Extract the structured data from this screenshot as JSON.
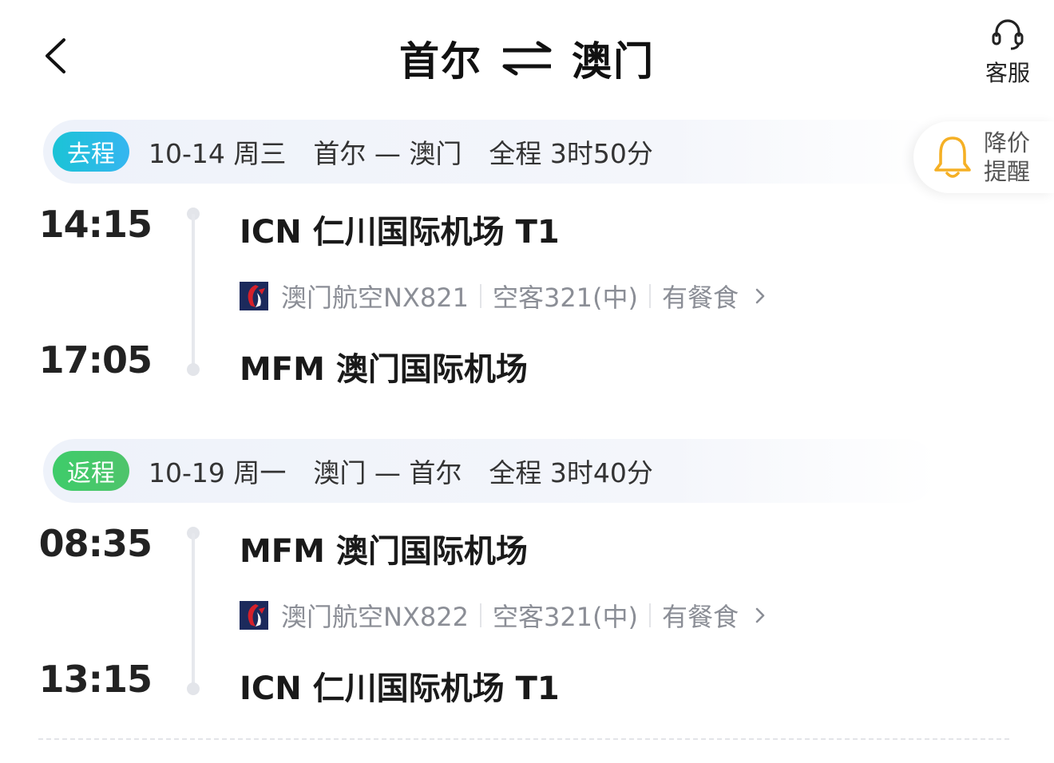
{
  "header": {
    "from": "首尔",
    "to": "澳门",
    "customer_service": "客服"
  },
  "price_alert": {
    "line1": "降价",
    "line2": "提醒"
  },
  "outbound": {
    "tag": "去程",
    "date": "10-14 周三",
    "route": "首尔 — 澳门",
    "duration": "全程 3时50分",
    "depart_time": "14:15",
    "depart_airport": "ICN 仁川国际机场 T1",
    "flight": "澳门航空NX821",
    "aircraft": "空客321(中)",
    "meal": "有餐食",
    "arrive_time": "17:05",
    "arrive_airport": "MFM 澳门国际机场"
  },
  "return": {
    "tag": "返程",
    "date": "10-19 周一",
    "route": "澳门 — 首尔",
    "duration": "全程 3时40分",
    "depart_time": "08:35",
    "depart_airport": "MFM 澳门国际机场",
    "flight": "澳门航空NX822",
    "aircraft": "空客321(中)",
    "meal": "有餐食",
    "arrive_time": "13:15",
    "arrive_airport": "ICN 仁川国际机场 T1"
  },
  "colors": {
    "outbound_tag": "#1bc3d6",
    "return_tag": "#3ecc6a",
    "alert_bell": "#f5b025",
    "airline_red": "#d6202a",
    "airline_navy": "#1c2a5c"
  },
  "icons": [
    "back-arrow-icon",
    "swap-arrows-icon",
    "headset-icon",
    "bell-icon",
    "airline-logo-icon",
    "chevron-right-icon"
  ]
}
